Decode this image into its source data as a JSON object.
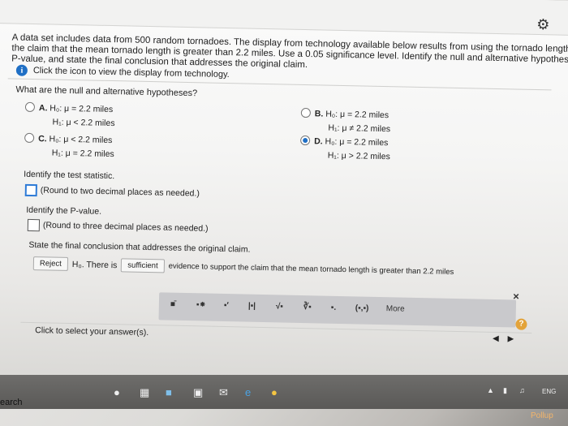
{
  "problem": {
    "line1": "A data set includes data from 500 random tornadoes. The display from technology available below results from using the tornado lengths (miles) to test",
    "line2": "the claim that the mean tornado length is greater than 2.2 miles. Use a 0.05 significance level. Identify the null and alternative hypotheses, test statistic,",
    "line3": "P-value, and state the final conclusion that addresses the original claim.",
    "info_icon": "i",
    "info_text": "Click the icon to view the display from technology."
  },
  "question1": "What are the null and alternative hypotheses?",
  "options": {
    "A": {
      "letter": "A.",
      "h0": "H₀: μ = 2.2 miles",
      "h1": "H₁: μ < 2.2 miles"
    },
    "B": {
      "letter": "B.",
      "h0": "H₀: μ = 2.2 miles",
      "h1": "H₁: μ ≠ 2.2 miles"
    },
    "C": {
      "letter": "C.",
      "h0": "H₀: μ < 2.2 miles",
      "h1": "H₁: μ = 2.2 miles"
    },
    "D": {
      "letter": "D.",
      "h0": "H₀: μ = 2.2 miles",
      "h1": "H₁: μ > 2.2 miles"
    }
  },
  "selected_option": "D",
  "test_stat": {
    "prompt": "Identify the test statistic.",
    "hint": "(Round to two decimal places as needed.)"
  },
  "p_value": {
    "prompt": "Identify the P-value.",
    "hint": "(Round to three decimal places as needed.)"
  },
  "conclusion": {
    "prompt": "State the final conclusion that addresses the original claim.",
    "reject": "Reject",
    "h0_there_is": "H₀. There is",
    "sufficient": "sufficient",
    "rest": "evidence to support the claim that the mean tornado length is greater than 2.2 miles"
  },
  "palette": {
    "b1": "■̄",
    "b2": "▪⁕",
    "b3": "▪′",
    "b4": "|▪|",
    "b5": "√▪",
    "b6": "∛▪",
    "b7": "▪.",
    "b8": "(▪,▪)",
    "more": "More"
  },
  "footer": {
    "hint": "Click to select your answer(s).",
    "prev": "◀",
    "next": "▶",
    "close": "×",
    "help": "?"
  },
  "taskbar": {
    "search": "earch",
    "tray": "ENG",
    "brand": "Pollup"
  },
  "icons": {
    "gear": "⚙"
  },
  "colors": {
    "accent": "#1f6fc5",
    "help": "#e3a33a"
  }
}
